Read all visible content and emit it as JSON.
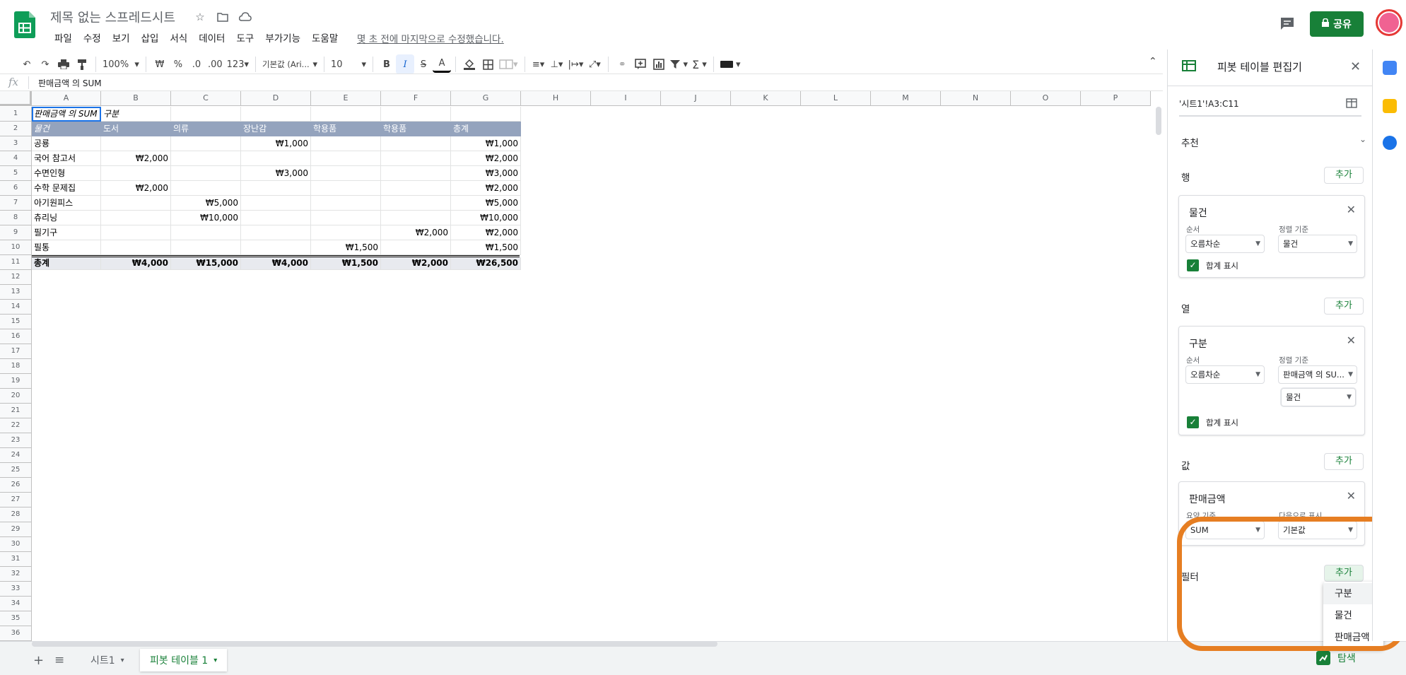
{
  "header": {
    "doc_title": "제목 없는 스프레드시트",
    "menu": [
      "파일",
      "수정",
      "보기",
      "삽입",
      "서식",
      "데이터",
      "도구",
      "부가기능",
      "도움말"
    ],
    "last_edit": "몇 초 전에 마지막으로 수정했습니다.",
    "share_label": "공유",
    "brand_color": "#188038"
  },
  "toolbar": {
    "zoom": "100%",
    "currency": "₩",
    "percent": "%",
    "dec_decrease": ".0",
    "dec_increase": ".00",
    "format_more": "123",
    "font": "기본값 (Ari...",
    "font_size": "10",
    "bold": "B",
    "italic": "I",
    "strike": "S",
    "text_color": "A",
    "sum": "Σ"
  },
  "formula_bar": {
    "fx": "fx",
    "content": "판매금액 의 SUM"
  },
  "grid": {
    "columns": [
      "A",
      "B",
      "C",
      "D",
      "E",
      "F",
      "G",
      "H",
      "I",
      "J",
      "K",
      "L",
      "M",
      "N",
      "O",
      "P"
    ],
    "rows": [
      "1",
      "2",
      "3",
      "4",
      "5",
      "6",
      "7",
      "8",
      "9",
      "10",
      "11",
      "12",
      "13",
      "14",
      "15",
      "16",
      "17",
      "18",
      "19",
      "20",
      "21",
      "22",
      "23",
      "24",
      "25",
      "26",
      "27",
      "28",
      "29",
      "30",
      "31",
      "32",
      "33",
      "34",
      "35",
      "36"
    ],
    "pivot": {
      "r1": [
        "판매금액 의 SUM",
        "구분",
        "",
        "",
        "",
        "",
        ""
      ],
      "r2": [
        "물건",
        "도서",
        "의류",
        "장난감",
        "학용품",
        "학용품",
        "총계"
      ],
      "body": [
        [
          "공룡",
          "",
          "",
          "₩1,000",
          "",
          "",
          "₩1,000"
        ],
        [
          "국어 참고서",
          "₩2,000",
          "",
          "",
          "",
          "",
          "₩2,000"
        ],
        [
          "수면인형",
          "",
          "",
          "₩3,000",
          "",
          "",
          "₩3,000"
        ],
        [
          "수학 문제집",
          "₩2,000",
          "",
          "",
          "",
          "",
          "₩2,000"
        ],
        [
          "아기원피스",
          "",
          "₩5,000",
          "",
          "",
          "",
          "₩5,000"
        ],
        [
          "츄리닝",
          "",
          "₩10,000",
          "",
          "",
          "",
          "₩10,000"
        ],
        [
          "필기구",
          "",
          "",
          "",
          "",
          "₩2,000",
          "₩2,000"
        ],
        [
          "필통",
          "",
          "",
          "",
          "₩1,500",
          "",
          "₩1,500"
        ]
      ],
      "total": [
        "총계",
        "₩4,000",
        "₩15,000",
        "₩4,000",
        "₩1,500",
        "₩2,000",
        "₩26,500"
      ]
    }
  },
  "sheets": {
    "tabs": [
      "시트1",
      "피봇 테이블 1"
    ],
    "active": "피봇 테이블 1",
    "explore": "탐색"
  },
  "panel": {
    "title": "피봇 테이블 편집기",
    "range": "'시트1'!A3:C11",
    "suggested": "추천",
    "add": "추가",
    "rows": {
      "label": "행",
      "card_title": "물건",
      "order_label": "순서",
      "order_value": "오름차순",
      "sort_label": "정렬 기준",
      "sort_value": "물건",
      "show_totals": "합계 표시"
    },
    "cols": {
      "label": "열",
      "card_title": "구분",
      "order_label": "순서",
      "order_value": "오름차순",
      "sort_label": "정렬 기준",
      "sort_value": "판매금액 의 SU...",
      "sort_value2": "물건",
      "show_totals": "합계 표시"
    },
    "values": {
      "label": "값",
      "card_title": "판매금액",
      "summarize_label": "요약 기준",
      "summarize_value": "SUM",
      "display_label": "다음으로 표시",
      "display_value": "기본값"
    },
    "filters": {
      "label": "필터",
      "options": [
        "구분",
        "물건",
        "판매금액"
      ]
    }
  }
}
